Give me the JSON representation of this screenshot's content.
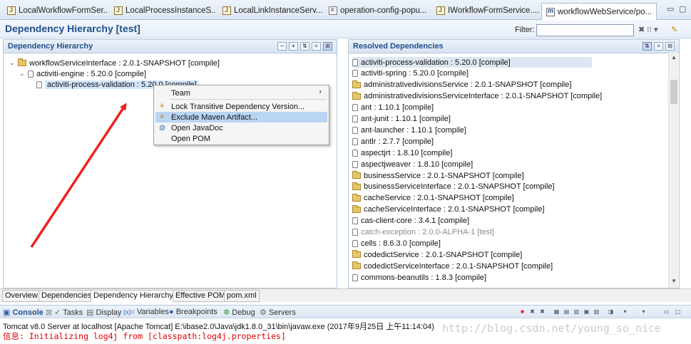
{
  "editor_tabs": [
    {
      "label": "LocalWorkflowFormSer...",
      "icon": "java-file-icon"
    },
    {
      "label": "LocalProcessInstanceS...",
      "icon": "java-file-icon"
    },
    {
      "label": "LocalLinkInstanceServ...",
      "icon": "java-file-icon"
    },
    {
      "label": "operation-config-popu...",
      "icon": "xml-file-icon"
    },
    {
      "label": "IWorkflowFormService....",
      "icon": "java-file-icon"
    },
    {
      "label": "workflowWebService/po...",
      "icon": "maven-pom-icon",
      "active": true,
      "close": "⊠"
    }
  ],
  "header": {
    "title": "Dependency Hierarchy [test]",
    "filter_label": "Filter:",
    "filter_value": ""
  },
  "left_pane": {
    "title": "Dependency Hierarchy",
    "tree": [
      {
        "label": "workflowServiceInterface : 2.0.1-SNAPSHOT [compile]",
        "level": 0,
        "icon": "folder"
      },
      {
        "label": "activiti-engine : 5.20.0 [compile]",
        "level": 1,
        "icon": "jar"
      },
      {
        "label": "activiti-process-validation : 5.20.0 [compile]",
        "level": 2,
        "icon": "jar",
        "selected": true
      }
    ]
  },
  "context_menu": {
    "items": [
      {
        "label": "Team",
        "submenu": true
      },
      {
        "label": "Lock Transitive Dependency Version...",
        "icon": "lock-version-icon"
      },
      {
        "label": "Exclude Maven Artifact...",
        "icon": "exclude-artifact-icon",
        "highlighted": true
      },
      {
        "label": "Open JavaDoc",
        "icon": "javadoc-icon"
      },
      {
        "label": "Open POM"
      }
    ]
  },
  "right_pane": {
    "title": "Resolved Dependencies",
    "items": [
      {
        "label": "activiti-process-validation : 5.20.0 [compile]",
        "icon": "jar"
      },
      {
        "label": "activiti-spring : 5.20.0 [compile]",
        "icon": "jar"
      },
      {
        "label": "administrativedivisionsService : 2.0.1-SNAPSHOT [compile]",
        "icon": "folder"
      },
      {
        "label": "administrativedivisionsServiceInterface : 2.0.1-SNAPSHOT [compile]",
        "icon": "folder"
      },
      {
        "label": "ant : 1.10.1 [compile]",
        "icon": "jar"
      },
      {
        "label": "ant-junit : 1.10.1 [compile]",
        "icon": "jar"
      },
      {
        "label": "ant-launcher : 1.10.1 [compile]",
        "icon": "jar"
      },
      {
        "label": "antlr : 2.7.7 [compile]",
        "icon": "jar"
      },
      {
        "label": "aspectjrt : 1.8.10 [compile]",
        "icon": "jar"
      },
      {
        "label": "aspectjweaver : 1.8.10 [compile]",
        "icon": "jar"
      },
      {
        "label": "businessService : 2.0.1-SNAPSHOT [compile]",
        "icon": "folder"
      },
      {
        "label": "businessServiceInterface : 2.0.1-SNAPSHOT [compile]",
        "icon": "folder"
      },
      {
        "label": "cacheService : 2.0.1-SNAPSHOT [compile]",
        "icon": "folder"
      },
      {
        "label": "cacheServiceInterface : 2.0.1-SNAPSHOT [compile]",
        "icon": "folder"
      },
      {
        "label": "cas-client-core : 3.4.1 [compile]",
        "icon": "jar"
      },
      {
        "label": "catch-exception : 2.0.0-ALPHA-1 [test]",
        "icon": "jar",
        "scope": "test"
      },
      {
        "label": "cells : 8.6.3.0 [compile]",
        "icon": "jar"
      },
      {
        "label": "codedictService : 2.0.1-SNAPSHOT [compile]",
        "icon": "folder"
      },
      {
        "label": "codedictServiceInterface : 2.0.1-SNAPSHOT [compile]",
        "icon": "folder"
      },
      {
        "label": "commons-beanutils : 1.8.3 [compile]",
        "icon": "jar"
      }
    ]
  },
  "bottom_tabs": [
    {
      "label": "Overview"
    },
    {
      "label": "Dependencies"
    },
    {
      "label": "Dependency Hierarchy",
      "active": true
    },
    {
      "label": "Effective POM"
    },
    {
      "label": "pom.xml"
    }
  ],
  "console_tabs": [
    {
      "label": "Console",
      "active": true
    },
    {
      "label": "Tasks"
    },
    {
      "label": "Display"
    },
    {
      "label": "Variables"
    },
    {
      "label": "Breakpoints"
    },
    {
      "label": "Debug"
    },
    {
      "label": "Servers"
    }
  ],
  "console": {
    "header": "Tomcat v8.0 Server at localhost [Apache Tomcat] E:\\ibase2.0\\Java\\jdk1.8.0_31\\bin\\javaw.exe (2017年9月25日 上午11:14:04)",
    "lines": [
      "信息: Initializing log4j from [classpath:log4j.properties]"
    ]
  },
  "watermark": "http://blog.csdn.net/young_so_nice",
  "colors": {
    "accent": "#1f4f8a",
    "selection": "#d3e5fb",
    "menu_highlight": "#b9d5f3",
    "arrow": "#ee2222",
    "console_text": "#e00000"
  }
}
